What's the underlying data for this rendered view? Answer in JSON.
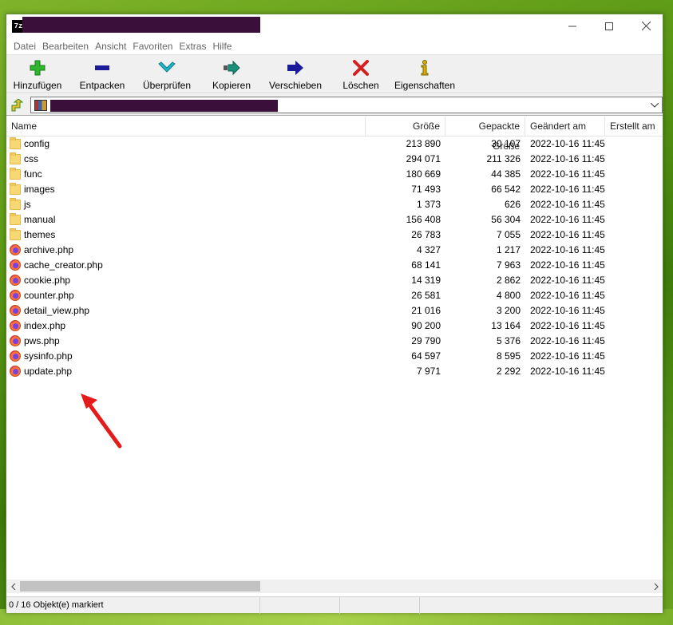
{
  "window": {
    "app_icon_text": "7z"
  },
  "menu": [
    "Datei",
    "Bearbeiten",
    "Ansicht",
    "Favoriten",
    "Extras",
    "Hilfe"
  ],
  "toolbar": [
    {
      "label": "Hinzufügen",
      "icon": "plus-icon",
      "color": "#2fb52f"
    },
    {
      "label": "Entpacken",
      "icon": "minus-icon",
      "color": "#1b1b9a"
    },
    {
      "label": "Überprüfen",
      "icon": "check-icon",
      "color": "#1fb6c8"
    },
    {
      "label": "Kopieren",
      "icon": "copy-arrow-icon",
      "color": "#1a8f7a"
    },
    {
      "label": "Verschieben",
      "icon": "move-arrow-icon",
      "color": "#1b1b9a"
    },
    {
      "label": "Löschen",
      "icon": "delete-x-icon",
      "color": "#d21f1f"
    },
    {
      "label": "Eigenschaften",
      "icon": "info-icon",
      "color": "#d4b000"
    }
  ],
  "columns": {
    "name": "Name",
    "size": "Größe",
    "packed": "Gepackte Größe",
    "modified": "Geändert am",
    "created": "Erstellt am"
  },
  "files": [
    {
      "name": "config",
      "type": "folder",
      "size": "213 890",
      "packed": "30 107",
      "modified": "2022-10-16 11:45"
    },
    {
      "name": "css",
      "type": "folder",
      "size": "294 071",
      "packed": "211 326",
      "modified": "2022-10-16 11:45"
    },
    {
      "name": "func",
      "type": "folder",
      "size": "180 669",
      "packed": "44 385",
      "modified": "2022-10-16 11:45"
    },
    {
      "name": "images",
      "type": "folder",
      "size": "71 493",
      "packed": "66 542",
      "modified": "2022-10-16 11:45"
    },
    {
      "name": "js",
      "type": "folder",
      "size": "1 373",
      "packed": "626",
      "modified": "2022-10-16 11:45"
    },
    {
      "name": "manual",
      "type": "folder",
      "size": "156 408",
      "packed": "56 304",
      "modified": "2022-10-16 11:45"
    },
    {
      "name": "themes",
      "type": "folder",
      "size": "26 783",
      "packed": "7 055",
      "modified": "2022-10-16 11:45"
    },
    {
      "name": "archive.php",
      "type": "php",
      "size": "4 327",
      "packed": "1 217",
      "modified": "2022-10-16 11:45"
    },
    {
      "name": "cache_creator.php",
      "type": "php",
      "size": "68 141",
      "packed": "7 963",
      "modified": "2022-10-16 11:45"
    },
    {
      "name": "cookie.php",
      "type": "php",
      "size": "14 319",
      "packed": "2 862",
      "modified": "2022-10-16 11:45"
    },
    {
      "name": "counter.php",
      "type": "php",
      "size": "26 581",
      "packed": "4 800",
      "modified": "2022-10-16 11:45"
    },
    {
      "name": "detail_view.php",
      "type": "php",
      "size": "21 016",
      "packed": "3 200",
      "modified": "2022-10-16 11:45"
    },
    {
      "name": "index.php",
      "type": "php",
      "size": "90 200",
      "packed": "13 164",
      "modified": "2022-10-16 11:45"
    },
    {
      "name": "pws.php",
      "type": "php",
      "size": "29 790",
      "packed": "5 376",
      "modified": "2022-10-16 11:45"
    },
    {
      "name": "sysinfo.php",
      "type": "php",
      "size": "64 597",
      "packed": "8 595",
      "modified": "2022-10-16 11:45"
    },
    {
      "name": "update.php",
      "type": "php",
      "size": "7 971",
      "packed": "2 292",
      "modified": "2022-10-16 11:45"
    }
  ],
  "status": {
    "selection": "0 / 16 Objekt(e) markiert"
  },
  "annotation": {
    "arrow_color": "#e31b1b"
  }
}
